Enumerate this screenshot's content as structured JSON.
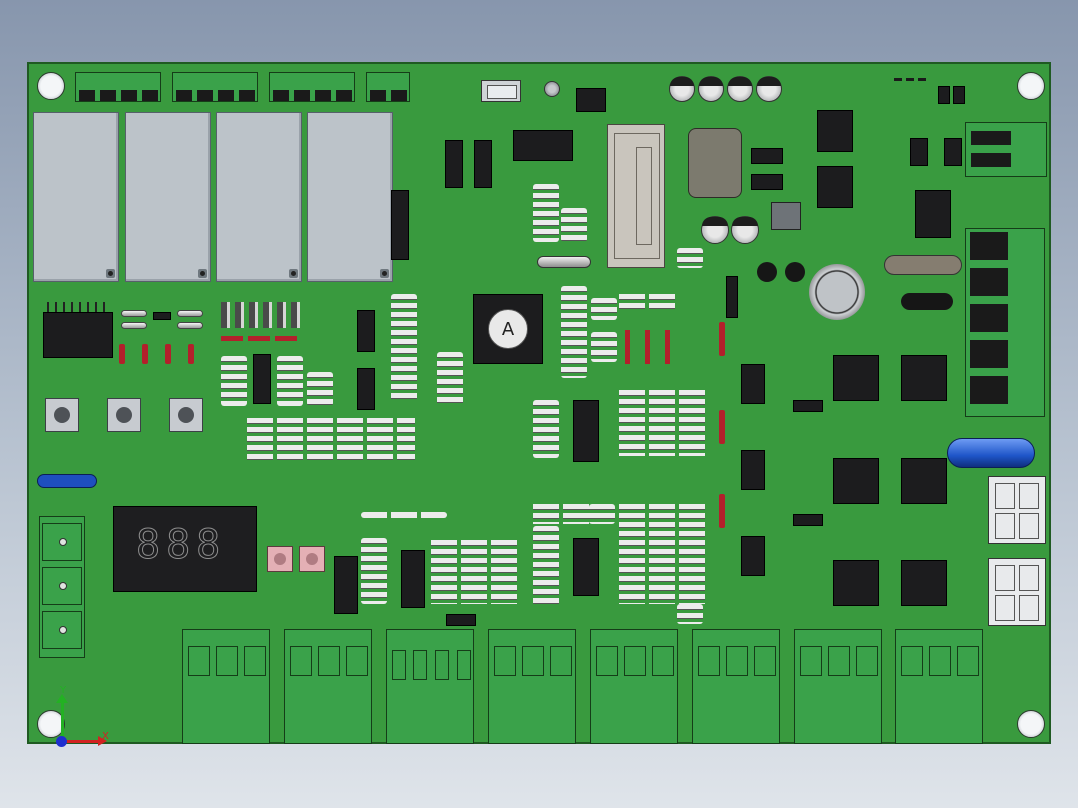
{
  "board": {
    "chip_label": "A",
    "display_digits": "888",
    "axis": {
      "y_label": "Y",
      "x_label": "X"
    }
  },
  "colors": {
    "background_top": "#8796ad",
    "pcb": "#399a3e",
    "terminal": "#3aa24a",
    "relay": "#bcc3c9",
    "ic": "#1c1c1e",
    "fuse": "#1e55c8",
    "resistor_red": "#b3202b"
  }
}
